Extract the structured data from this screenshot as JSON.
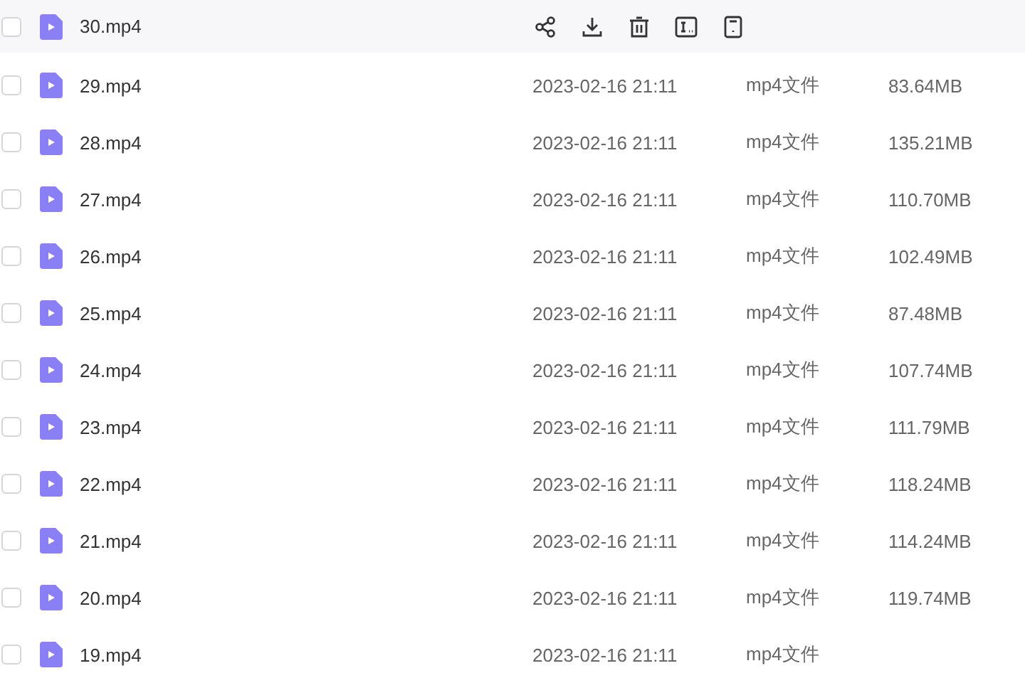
{
  "rows": [
    {
      "name": "30.mp4",
      "hovered": true,
      "checked": false,
      "actions": [
        {
          "kind": "share"
        },
        {
          "kind": "download"
        },
        {
          "kind": "delete"
        },
        {
          "kind": "rename"
        },
        {
          "kind": "details"
        }
      ]
    },
    {
      "name": "29.mp4",
      "hovered": false,
      "checked": false,
      "date": "2023-02-16 21:11",
      "type": "mp4文件",
      "size": "83.64MB"
    },
    {
      "name": "28.mp4",
      "hovered": false,
      "checked": false,
      "date": "2023-02-16 21:11",
      "type": "mp4文件",
      "size": "135.21MB"
    },
    {
      "name": "27.mp4",
      "hovered": false,
      "checked": false,
      "date": "2023-02-16 21:11",
      "type": "mp4文件",
      "size": "110.70MB"
    },
    {
      "name": "26.mp4",
      "hovered": false,
      "checked": false,
      "date": "2023-02-16 21:11",
      "type": "mp4文件",
      "size": "102.49MB"
    },
    {
      "name": "25.mp4",
      "hovered": false,
      "checked": false,
      "date": "2023-02-16 21:11",
      "type": "mp4文件",
      "size": "87.48MB"
    },
    {
      "name": "24.mp4",
      "hovered": false,
      "checked": false,
      "date": "2023-02-16 21:11",
      "type": "mp4文件",
      "size": "107.74MB"
    },
    {
      "name": "23.mp4",
      "hovered": false,
      "checked": false,
      "date": "2023-02-16 21:11",
      "type": "mp4文件",
      "size": "111.79MB"
    },
    {
      "name": "22.mp4",
      "hovered": false,
      "checked": false,
      "date": "2023-02-16 21:11",
      "type": "mp4文件",
      "size": "118.24MB"
    },
    {
      "name": "21.mp4",
      "hovered": false,
      "checked": false,
      "date": "2023-02-16 21:11",
      "type": "mp4文件",
      "size": "114.24MB"
    },
    {
      "name": "20.mp4",
      "hovered": false,
      "checked": false,
      "date": "2023-02-16 21:11",
      "type": "mp4文件",
      "size": "119.74MB"
    },
    {
      "name": "19.mp4",
      "hovered": false,
      "checked": false,
      "date": "2023-02-16 21:11",
      "type": "mp4文件"
    }
  ]
}
